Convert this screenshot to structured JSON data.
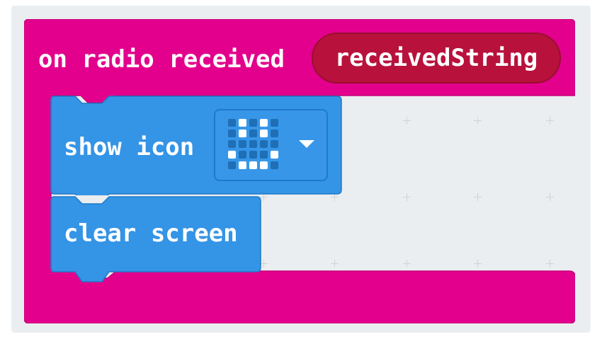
{
  "event_block": {
    "label": "on radio received",
    "parameter": "receivedString",
    "color": "#e3008c",
    "parameter_color": "#b8123c"
  },
  "statements": [
    {
      "label": "show icon",
      "color": "#3494e6",
      "icon": {
        "name": "happy-face-icon",
        "leds": [
          [
            0,
            1,
            0,
            1,
            0
          ],
          [
            0,
            1,
            0,
            1,
            0
          ],
          [
            0,
            0,
            0,
            0,
            0
          ],
          [
            1,
            0,
            0,
            0,
            1
          ],
          [
            0,
            1,
            1,
            1,
            0
          ]
        ]
      },
      "dropdown_icon": "chevron-down-icon"
    },
    {
      "label": "clear screen",
      "color": "#3494e6"
    }
  ],
  "workspace": {
    "background": "#ebeef0"
  }
}
